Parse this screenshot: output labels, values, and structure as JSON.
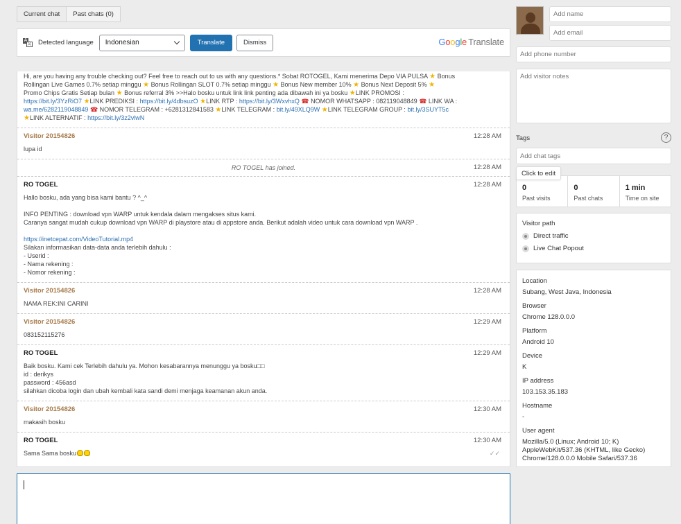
{
  "tabs": [
    {
      "label": "Current chat"
    },
    {
      "label": "Past chats (0)"
    }
  ],
  "translate": {
    "detected_label": "Detected language",
    "language": "Indonesian",
    "translate_label": "Translate",
    "dismiss_label": "Dismiss",
    "logo_google": [
      "G",
      "o",
      "o",
      "g",
      "l",
      "e"
    ],
    "logo_translate": "Translate"
  },
  "messages": {
    "m0_line1": "Hi, are you having any trouble checking out? Feel free to reach out to us with any questions.* Sobat ROTOGEL, Kami menerima Depo VIA PULSA",
    "m0_line1b": "Bonus",
    "m0_line2a": "Rollingan Live Games 0.7% setiap minggu",
    "m0_line2b": "Bonus Rollingan SLOT 0.7% setiap minggu",
    "m0_line2c": "Bonus New member 10%",
    "m0_line2d": "Bonus Next Deposit 5%",
    "m0_line3a": "Promo Chips Gratis Setiap bulan",
    "m0_line3b": "Bonus referral 3% >>Halo bosku untuk link link penting ada dibawah ini ya bosku",
    "m0_line3c": "LINK PROMOSI :",
    "link_promosi": "https://bit.ly/3YzRiO7",
    "m0_link_prediksi_label": "LINK PREDIKSI :",
    "link_prediksi": "https://bit.ly/4dbsuzO",
    "m0_link_rtp_label": "LINK RTP :",
    "link_rtp": "https://bit.ly/3WxvhxQ",
    "m0_wa_label": "NOMOR WHATSAPP : 082119048849",
    "m0_link_wa_label": "LINK WA :",
    "link_wa": "wa.me/6282119048849",
    "m0_telegram_label": "NOMOR TELEGRAM : +6281312841583",
    "m0_link_telegram_label": "LINK TELEGRAM :",
    "link_telegram": "bit.ly/49XLQ9W",
    "m0_link_telegram_group_label": "LINK TELEGRAM GROUP :",
    "link_telegram_group": "bit.ly/3SUYT5c",
    "m0_link_alternatif_label": "LINK ALTERNATIF :",
    "link_alternatif": "https://bit.ly/3z2vlwN",
    "m1_author": "Visitor 20154826",
    "m1_time": "12:28 AM",
    "m1_body": "lupa id",
    "sys_joined_author": "RO TOGEL",
    "sys_joined_text": "has joined.",
    "sys_joined_time": "12:28 AM",
    "m2_author": "RO TOGEL",
    "m2_time": "12:28 AM",
    "m2_body_1": "Hallo bosku, ada yang bisa kami bantu ? ^_^\n\nINFO PENTING : download vpn WARP untuk kendala dalam mengakses situs kami.\nCaranya sangat mudah cukup download vpn WARP di playstore atau di appstore anda. Berikut adalah video untuk cara download vpn WARP .\n\n",
    "m2_link": "https://inetcepat.com/VideoTutorial.mp4",
    "m2_body_2": "Silakan informasikan data-data anda terlebih dahulu :\n- Userid :\n- Nama rekening :\n- Nomor rekening :",
    "m3_author": "Visitor 20154826",
    "m3_time": "12:28 AM",
    "m3_body": "NAMA REK:INI CARINI",
    "m4_author": "Visitor 20154826",
    "m4_time": "12:29 AM",
    "m4_body": "083152115276",
    "m5_author": "RO TOGEL",
    "m5_time": "12:29 AM",
    "m5_body": "Baik bosku. Kami cek Terlebih dahulu ya. Mohon kesabarannya menunggu ya bosku□□\nid : derikys\npassword : 456asd\nsilahkan dicoba login dan ubah kembali kata sandi demi menjaga keamanan akun anda.",
    "m6_author": "Visitor 20154826",
    "m6_time": "12:30 AM",
    "m6_body": "makasih bosku",
    "m7_author": "RO TOGEL",
    "m7_time": "12:30 AM",
    "m7_body": "Sama Sama bosku"
  },
  "visitor": {
    "name_placeholder": "Add name",
    "email_placeholder": "Add email",
    "phone_placeholder": "Add phone number",
    "notes_placeholder": "Add visitor notes",
    "tags_label": "Tags",
    "tags_placeholder": "Add chat tags",
    "tooltip": "Click to edit",
    "stats": [
      {
        "value": "0",
        "label": "Past visits"
      },
      {
        "value": "0",
        "label": "Past chats"
      },
      {
        "value": "1 min",
        "label": "Time on site"
      }
    ],
    "path_title": "Visitor path",
    "path": [
      {
        "label": "Direct traffic"
      },
      {
        "label": "Live Chat Popout"
      }
    ],
    "info": [
      {
        "label": "Location",
        "value": "Subang, West Java, Indonesia"
      },
      {
        "label": "Browser",
        "value": "Chrome 128.0.0.0"
      },
      {
        "label": "Platform",
        "value": "Android 10"
      },
      {
        "label": "Device",
        "value": "K"
      },
      {
        "label": "IP address",
        "value": "103.153.35.183"
      },
      {
        "label": "Hostname",
        "value": "-"
      },
      {
        "label": "User agent",
        "value": "Mozilla/5.0 (Linux; Android 10; K) AppleWebKit/537.36 (KHTML, like Gecko) Chrome/128.0.0.0 Mobile Safari/537.36"
      }
    ]
  },
  "colors": {
    "primary": "#2271b1",
    "visitor_author": "#a77a4a",
    "link": "#2d6fb0"
  }
}
